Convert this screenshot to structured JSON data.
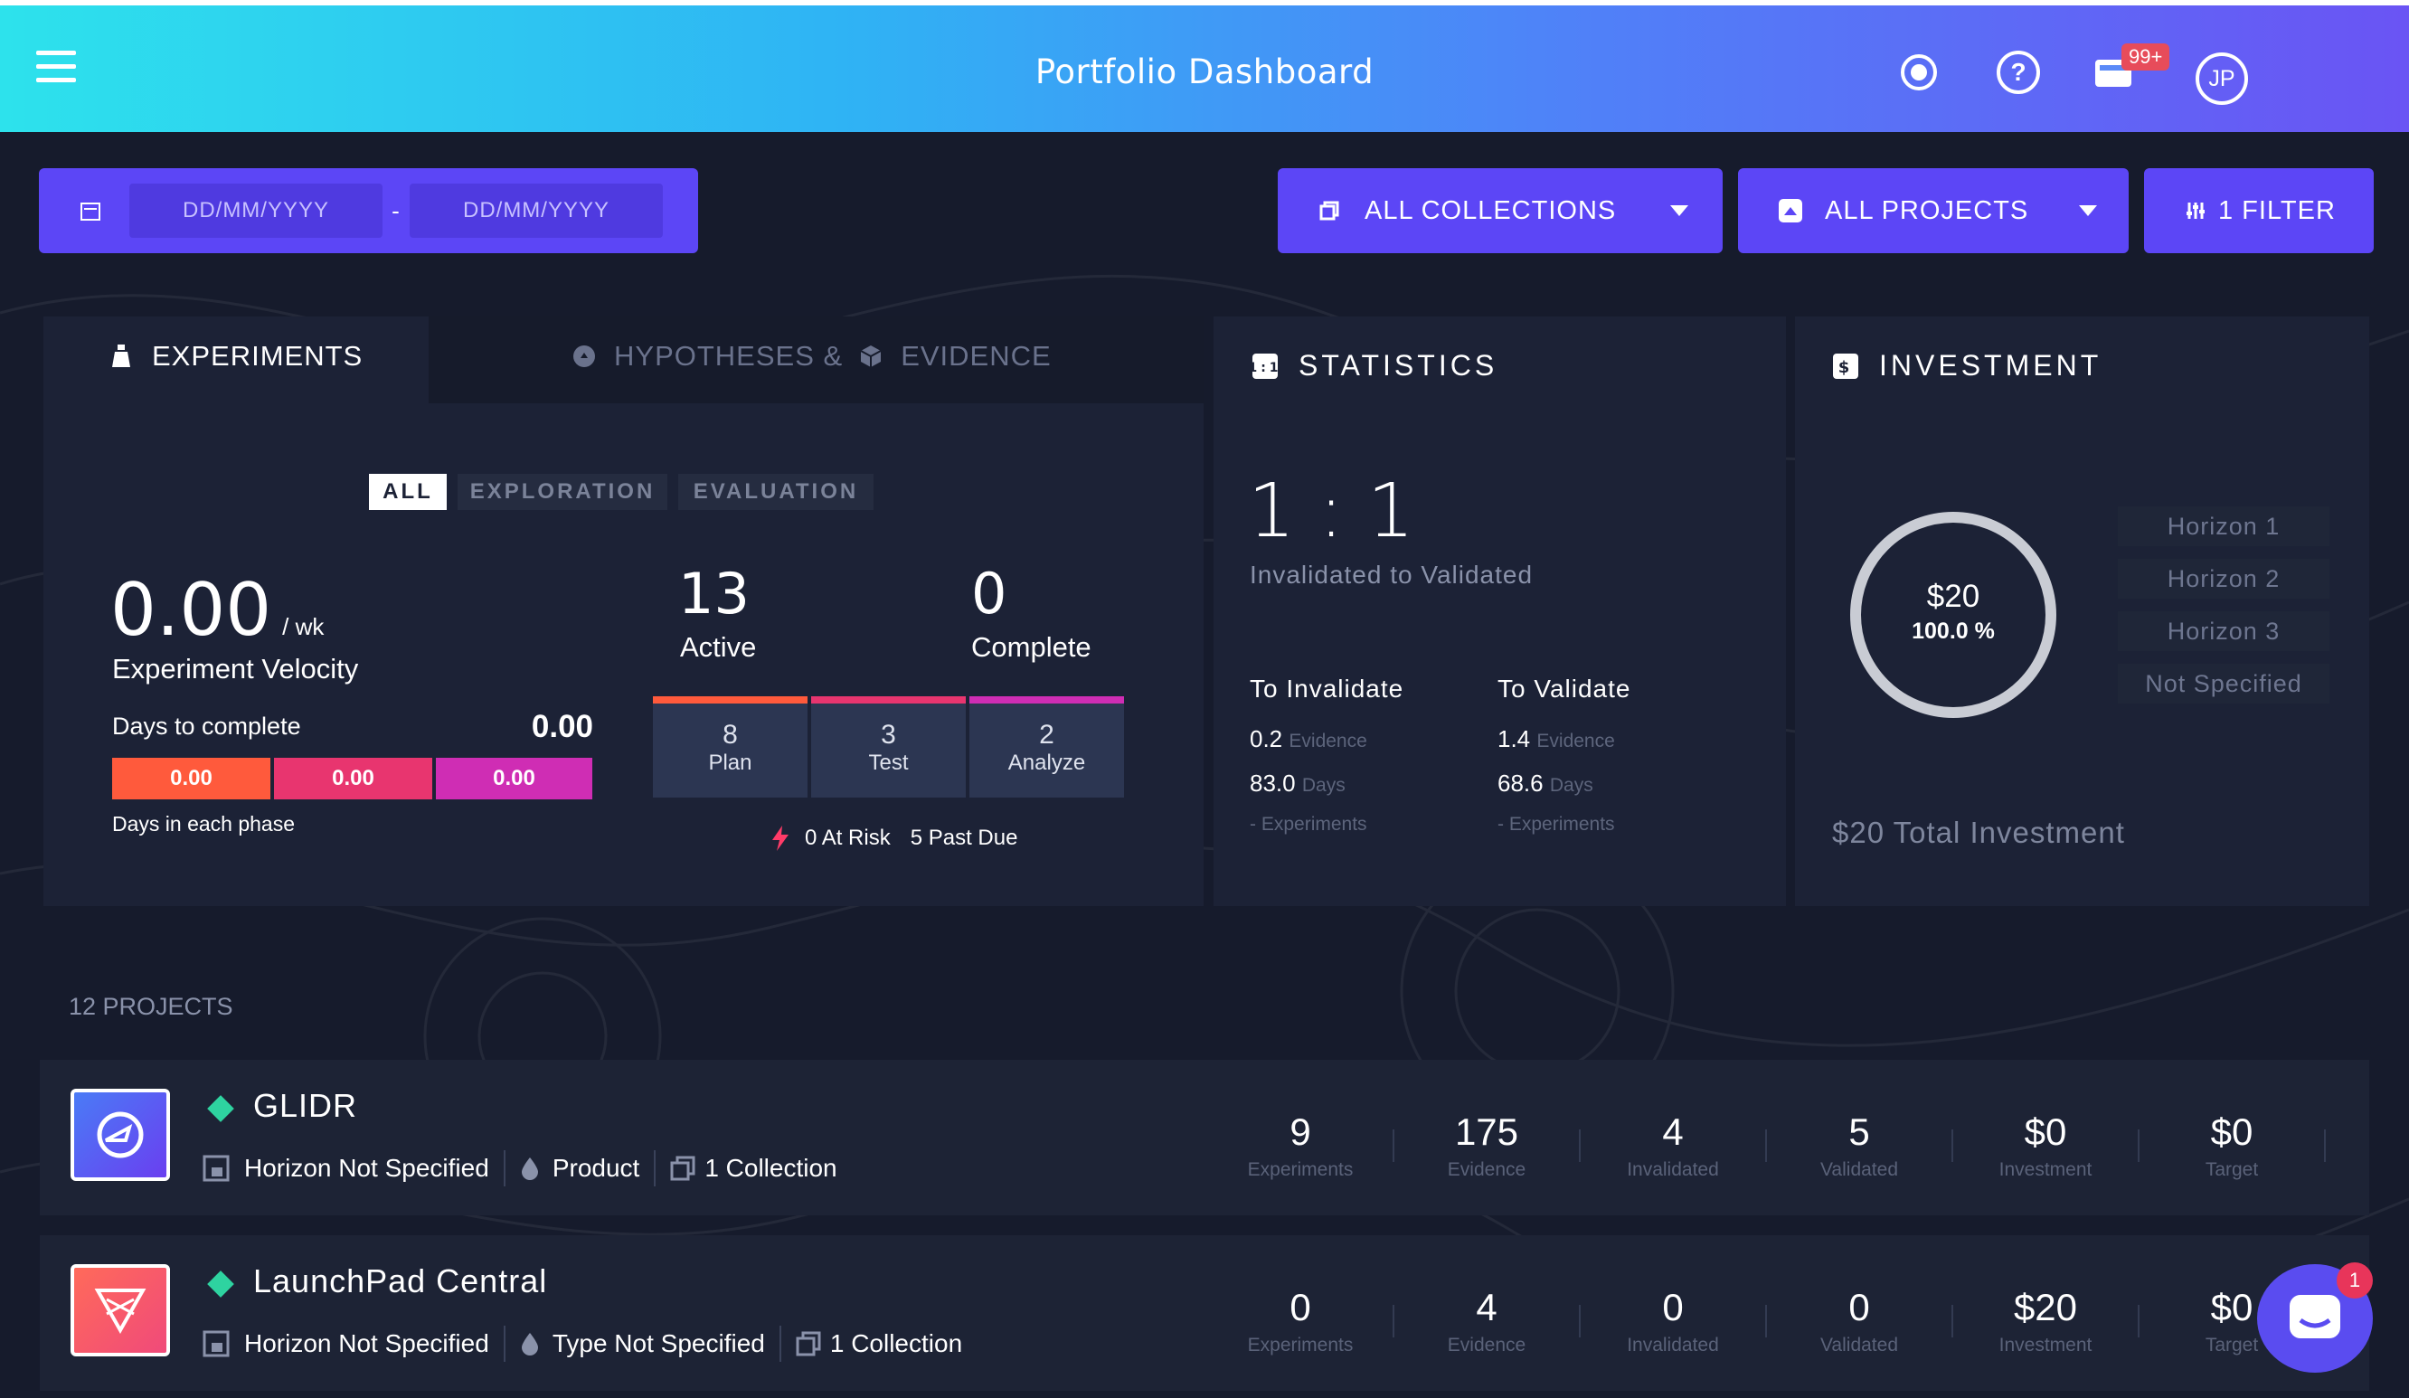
{
  "header": {
    "title": "Portfolio Dashboard",
    "notif_badge": "99+",
    "avatar": "JP"
  },
  "toolbar": {
    "date_from_placeholder": "DD/MM/YYYY",
    "date_sep": "-",
    "date_to_placeholder": "DD/MM/YYYY",
    "collections_label": "ALL COLLECTIONS",
    "projects_label": "ALL PROJECTS",
    "filter_label": "1 FILTER"
  },
  "experiments": {
    "tab_experiments": "EXPERIMENTS",
    "tab_hypotheses": "HYPOTHESES &",
    "tab_evidence": "EVIDENCE",
    "seg_all": "ALL",
    "seg_exploration": "EXPLORATION",
    "seg_evaluation": "EVALUATION",
    "velocity": "0.00",
    "velocity_unit": "/ wk",
    "velocity_label": "Experiment Velocity",
    "days_label": "Days to complete",
    "days_value": "0.00",
    "phase_values": [
      "0.00",
      "0.00",
      "0.00"
    ],
    "phase_caption": "Days in each phase",
    "active_count": "13",
    "active_label": "Active",
    "complete_count": "0",
    "complete_label": "Complete",
    "stages": [
      {
        "n": "8",
        "l": "Plan"
      },
      {
        "n": "3",
        "l": "Test"
      },
      {
        "n": "2",
        "l": "Analyze"
      }
    ],
    "at_risk": "0 At Risk",
    "past_due": "5 Past Due"
  },
  "statistics": {
    "title": "STATISTICS",
    "ratio": "1 : 1",
    "ratio_label": "Invalidated to Validated",
    "invalidate": {
      "heading": "To Invalidate",
      "evidence": "0.2",
      "evidence_unit": "Evidence",
      "days": "83.0",
      "days_unit": "Days",
      "exp": "-",
      "exp_unit": "Experiments"
    },
    "validate": {
      "heading": "To Validate",
      "evidence": "1.4",
      "evidence_unit": "Evidence",
      "days": "68.6",
      "days_unit": "Days",
      "exp": "-",
      "exp_unit": "Experiments"
    }
  },
  "investment": {
    "title": "INVESTMENT",
    "amount": "$20",
    "percent": "100.0 %",
    "ring_fraction": 1.0,
    "horizons": [
      "Horizon 1",
      "Horizon 2",
      "Horizon 3",
      "Not Specified"
    ],
    "total": "$20 Total Investment"
  },
  "projects": {
    "count_label": "12 PROJECTS",
    "items": [
      {
        "name": "GLIDR",
        "horizon": "Horizon Not Specified",
        "type": "Product",
        "collection": "1 Collection",
        "stats": [
          {
            "v": "9",
            "l": "Experiments"
          },
          {
            "v": "175",
            "l": "Evidence"
          },
          {
            "v": "4",
            "l": "Invalidated"
          },
          {
            "v": "5",
            "l": "Validated"
          },
          {
            "v": "$0",
            "l": "Investment"
          },
          {
            "v": "$0",
            "l": "Target"
          }
        ]
      },
      {
        "name": "LaunchPad Central",
        "horizon": "Horizon Not Specified",
        "type": "Type Not Specified",
        "collection": "1 Collection",
        "stats": [
          {
            "v": "0",
            "l": "Experiments"
          },
          {
            "v": "4",
            "l": "Evidence"
          },
          {
            "v": "0",
            "l": "Invalidated"
          },
          {
            "v": "0",
            "l": "Validated"
          },
          {
            "v": "$20",
            "l": "Investment"
          },
          {
            "v": "$0",
            "l": "Target"
          }
        ]
      }
    ]
  },
  "chat": {
    "badge": "1"
  },
  "colors": {
    "accent": "#5c46f6",
    "phase1": "#ff5a3c",
    "phase2": "#e8356f",
    "phase3": "#cf2db4",
    "diamond": "#2ed3a0"
  }
}
